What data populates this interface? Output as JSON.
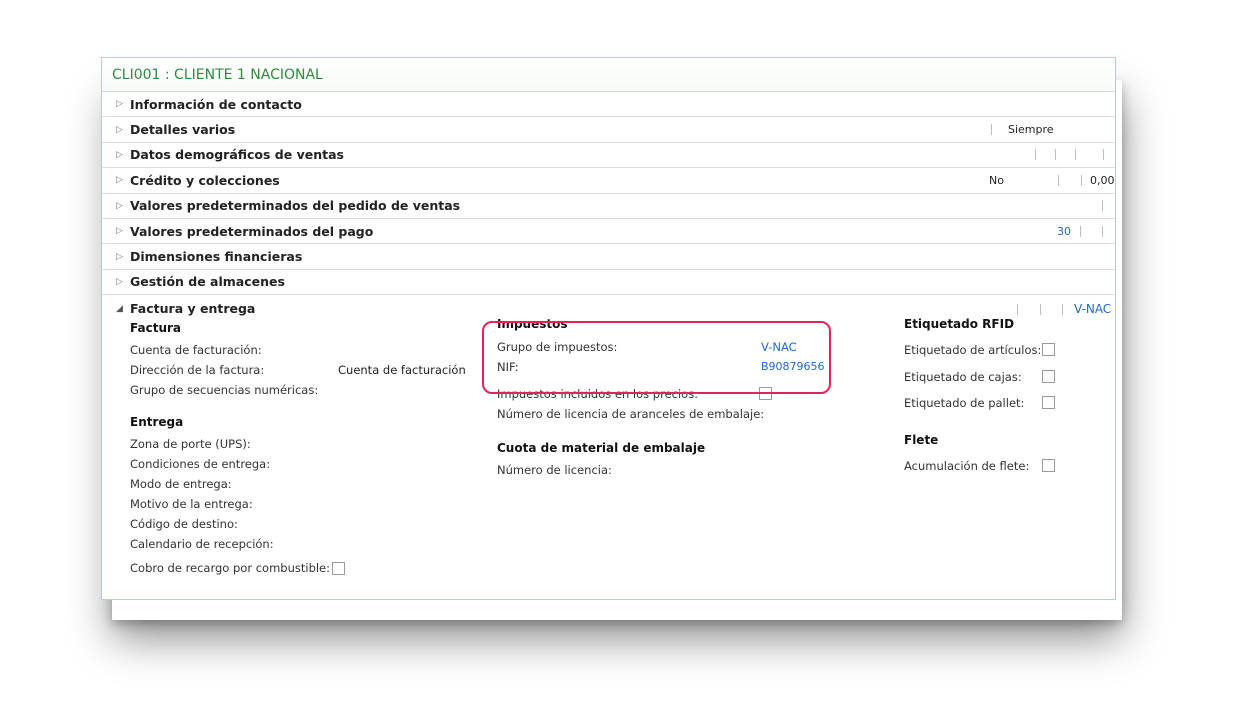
{
  "title": "CLI001 : CLIENTE 1 NACIONAL",
  "fasttabs": [
    {
      "label": "Información de contacto"
    },
    {
      "label": "Detalles varios",
      "summary": "Siempre"
    },
    {
      "label": "Datos demográficos de ventas"
    },
    {
      "label": "Crédito y colecciones",
      "summary": "No",
      "summary2": "0,00"
    },
    {
      "label": "Valores predeterminados del pedido de ventas"
    },
    {
      "label": "Valores predeterminados del pago",
      "summary": "30"
    },
    {
      "label": "Dimensiones financieras"
    },
    {
      "label": "Gestión de almacenes"
    }
  ],
  "expanded": {
    "label": "Factura y entrega",
    "summary": "V-NAC",
    "factura": {
      "title": "Factura",
      "cuenta_facturacion": "Cuenta de facturación:",
      "direccion_factura": "Dirección de la factura:",
      "direccion_factura_value": "Cuenta de facturación",
      "grupo_secuencias": "Grupo de secuencias numéricas:"
    },
    "entrega": {
      "title": "Entrega",
      "zona_porte": "Zona de porte (UPS):",
      "condiciones": "Condiciones de entrega:",
      "modo": "Modo de entrega:",
      "motivo": "Motivo de la entrega:",
      "codigo_destino": "Código de destino:",
      "calendario": "Calendario de recepción:",
      "cobro_recargo": "Cobro de recargo por combustible:"
    },
    "impuestos": {
      "title": "Impuestos",
      "grupo": "Grupo de impuestos:",
      "grupo_value": "V-NAC",
      "nif": "NIF:",
      "nif_value": "B90879656",
      "incluidos": "Impuestos incluidos en los precios:",
      "licencia_aranceles": "Número de licencia de aranceles de embalaje:"
    },
    "cuota": {
      "title": "Cuota de material de embalaje",
      "licencia": "Número de licencia:"
    },
    "rfid": {
      "title": "Etiquetado RFID",
      "articulos": "Etiquetado de artículos:",
      "cajas": "Etiquetado de cajas:",
      "pallet": "Etiquetado de pallet:"
    },
    "flete": {
      "title": "Flete",
      "acumulacion": "Acumulación de flete:"
    }
  }
}
